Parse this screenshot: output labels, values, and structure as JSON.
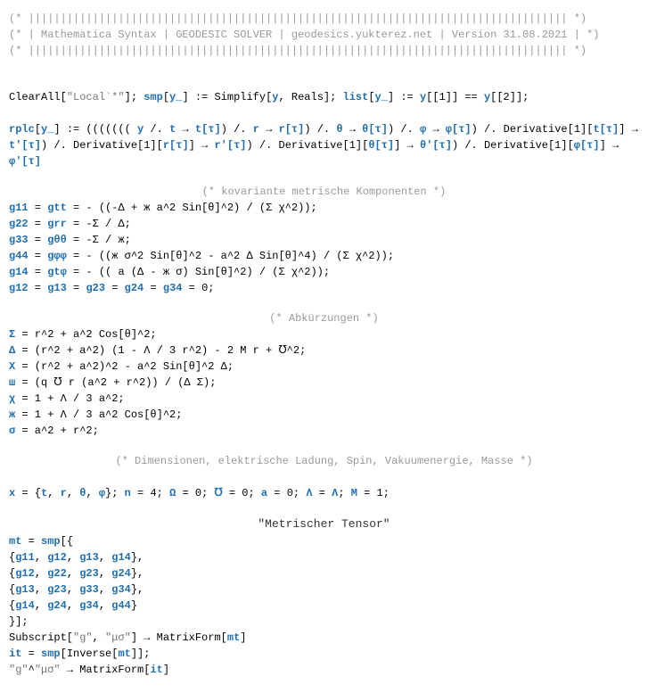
{
  "header": {
    "bar": "(* |||||||||||||||||||||||||||||||||||||||||||||||||||||||||||||||||||||||||||||||||||| *)",
    "title": "(* | Mathematica Syntax | GEODESIC SOLVER | geodesics.yukterez.net | Version 31.08.2021 | *)"
  },
  "b1": {
    "clearall_l": "ClearAll[",
    "clearall_str": "\"Local`*\"",
    "clearall_r": "]; ",
    "smp_l": "smp",
    "smp_def": "[",
    "smp_arg": "y_",
    "smp_mid": "] := Simplify[",
    "smp_y": "y",
    "smp_r": ", Reals]; ",
    "list_l": "list",
    "list_arg": "y_",
    "list_mid": "] := ",
    "list_y1": "y",
    "list_i1": "[[1]] == ",
    "list_y2": "y",
    "list_i2": "[[2]];",
    "rplc_l": "rplc",
    "rplc_arg": "y_",
    "rplc_mid": "] := ((((((( ",
    "rplc_y": "y",
    "rplc_t1": " /. ",
    "rplc_tv": "t",
    "rplc_to": " → ",
    "rplc_tf": "t[τ]",
    "rplc_r1": ") /. ",
    "rplc_rv": "r",
    "rplc_rf": "r[τ]",
    "rplc_th1": ") /. ",
    "rplc_thv": "θ",
    "rplc_thf": "θ[τ]",
    "rplc_ph1": ") /. ",
    "rplc_phv": "φ",
    "rplc_phf": "φ[τ]",
    "rplc_d1": ") /. Derivative[1][",
    "rplc_dt": "t[τ]",
    "rplc_dto": "] → ",
    "rplc_dtp": "t'[τ]",
    "rplc_d2": ") /. Derivative[1][",
    "rplc_dr": "r[τ]",
    "rplc_dro": "] → ",
    "rplc_drp": "r'[τ]",
    "rplc_d3": ") /. Derivative[1][",
    "rplc_dth": "θ[τ]",
    "rplc_dtho": "] → ",
    "rplc_dthp": "θ'[τ]",
    "rplc_d4": ") /. Derivative[1][",
    "rplc_dph": "φ[τ]",
    "rplc_dpho": "] → ",
    "rplc_dphp": "φ'[τ]"
  },
  "c1": "(* kovariante metrische Komponenten *)",
  "g": {
    "g11": "g11",
    "gtt": "gtt",
    "g11rhs": " = - ((-Δ + ж a^2 Sin[θ]^2) / (Σ χ^2));",
    "g22": "g22",
    "grr": "grr",
    "g22rhs": " = -Σ / Δ;",
    "g33": "g33",
    "gthth": "gθθ",
    "g33rhs": " = -Σ / ж;",
    "g44": "g44",
    "gphph": "gφφ",
    "g44rhs": " = - ((ж σ^2 Sin[θ]^2 - a^2 Δ Sin[θ]^4) / (Σ χ^2));",
    "g14": "g14",
    "gtph": "gtφ",
    "g14rhs": " = - (( a (Δ - ж σ) Sin[θ]^2) / (Σ χ^2));",
    "zeros_l": "g12",
    "zeros_m1": "g13",
    "zeros_m2": "g23",
    "zeros_m3": "g24",
    "zeros_m4": "g34",
    "zeros_r": " = 0;"
  },
  "c2": "(* Abkürzungen *)",
  "ab": {
    "S": "Σ",
    "Srhs": " = r^2 + a^2 Cos[θ]^2;",
    "D": "Δ",
    "Drhs": " = (r^2 + a^2) (1 - Λ / 3 r^2) - 2 M r + ℧^2;",
    "X": "Χ",
    "Xrhs": " = (r^2 + a^2)^2 - a^2 Sin[θ]^2 Δ;",
    "w": "ш",
    "wrhs": " = (q ℧ r (a^2 + r^2)) / (Δ Σ);",
    "chi": "χ",
    "chirhs": " = 1 + Λ / 3 a^2;",
    "zh": "ж",
    "zhrhs": " = 1 + Λ / 3 a^2 Cos[θ]^2;",
    "sig": "σ",
    "sigrhs": " = a^2 + r^2;"
  },
  "c3": "(* Dimensionen, elektrische Ladung, Spin, Vakuumenergie, Masse *)",
  "dims": {
    "x": "x",
    "xrhs": " = {",
    "t": "t",
    "c": ", ",
    "r": "r",
    "th": "θ",
    "ph": "φ",
    "close": "}; ",
    "n": "n",
    "nrhs": " = 4; ",
    "Q": "Ω",
    "Qrhs": " = 0; ",
    "U": "℧",
    "Urhs": " = 0; ",
    "a": "a",
    "arhs": " = 0; ",
    "L": "Λ",
    "Lrhs_l": " = ",
    "Lrhs_v": "Λ",
    "Lrhs_r": "; ",
    "M": "M",
    "Mrhs": " = 1;"
  },
  "mt_title": "\"Metrischer Tensor\"",
  "mt": {
    "mt": "mt",
    "open": " = ",
    "smp": "smp",
    "r1_1": "g11",
    "r1_2": "g12",
    "r1_3": "g13",
    "r1_4": "g14",
    "r2_1": "g12",
    "r2_2": "g22",
    "r2_3": "g23",
    "r2_4": "g24",
    "r3_1": "g13",
    "r3_2": "g23",
    "r3_3": "g33",
    "r3_4": "g34",
    "r4_1": "g14",
    "r4_2": "g24",
    "r4_3": "g34",
    "r4_4": "g44",
    "sub_l": "Subscript[",
    "sub_g": "\"g\"",
    "sub_c": ", ",
    "sub_mu": "\"μσ\"",
    "sub_r": "] → MatrixForm[",
    "sub_mt": "mt",
    "sub_e": "]",
    "it": "it",
    "inv_l": " = ",
    "inv_smp": "smp",
    "inv_open": "[Inverse[",
    "inv_mt": "mt",
    "inv_close": "]];",
    "sup_l": "\"g\"",
    "sup_c": "^",
    "sup_mu": "\"μσ\"",
    "sup_r": " → MatrixForm[",
    "sup_it": "it",
    "sup_e": "]"
  }
}
